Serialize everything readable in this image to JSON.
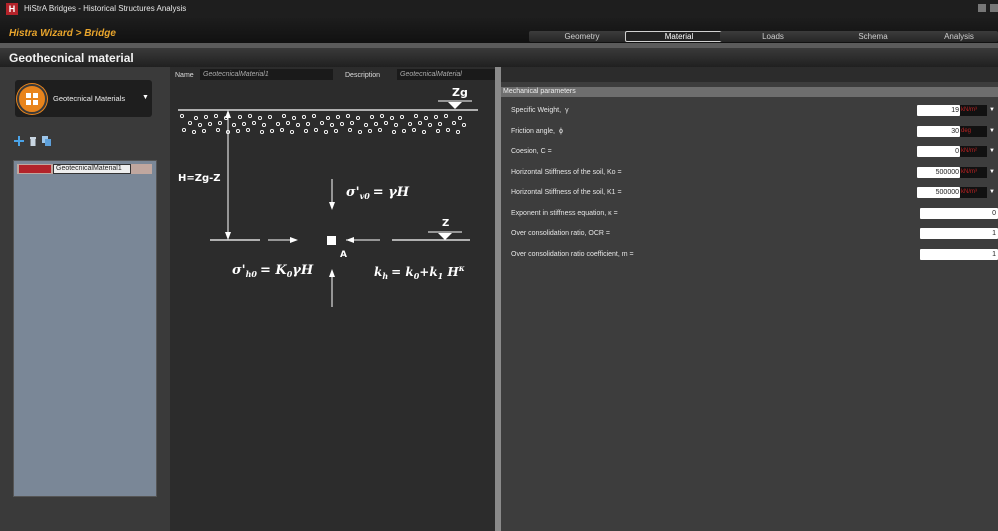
{
  "window": {
    "logo": "H",
    "title": "HiStrA Bridges - Historical Structures Analysis"
  },
  "wizard": {
    "breadcrumb": "Histra Wizard > Bridge",
    "tabs": [
      {
        "label": "Geometry",
        "active": false
      },
      {
        "label": "Material",
        "active": true
      },
      {
        "label": "Loads",
        "active": false
      },
      {
        "label": "Schema",
        "active": false
      },
      {
        "label": "Analysis",
        "active": false
      }
    ]
  },
  "section": {
    "title": "Geothecnical material"
  },
  "left": {
    "dropdown_label": "Geotecnical Materials",
    "materials": [
      {
        "name": "GeotecnicalMaterial1",
        "color": "#b2232a"
      }
    ]
  },
  "form": {
    "name_label": "Name",
    "name_value": "GeotecnicalMaterial1",
    "description_label": "Description",
    "description_value": "GeotecnicalMaterial"
  },
  "diagram": {
    "zg": "Zg",
    "h_label": "H=Zg-Z",
    "z": "Z",
    "point": "A",
    "sigma_v_lhs": "σ'",
    "sigma_v_sub": "v0",
    "sigma_v_rhs": "= γH",
    "sigma_h_lhs": "σ'",
    "sigma_h_sub": "h0",
    "sigma_h_rhs": "= K",
    "sigma_h_k_sub": "0",
    "sigma_h_tail": "γH",
    "kh_lhs": "k",
    "kh_sub": "h",
    "kh_rhs": "= k",
    "kh_k0_sub": "0",
    "kh_plus": "+k",
    "kh_k1_sub": "1",
    "kh_tail": " H",
    "kh_exp": "κ"
  },
  "mechanical": {
    "header": "Mechanical parameters",
    "params": [
      {
        "label": "Specific Weight,",
        "symbol": "γ",
        "value": "19",
        "unit": "kN/m³",
        "has_unit": true
      },
      {
        "label": "Friction angle,",
        "symbol": "ϕ",
        "value": "30",
        "unit": "deg",
        "has_unit": true
      },
      {
        "label": "Coesion, C =",
        "symbol": "",
        "value": "0",
        "unit": "kN/m²",
        "has_unit": true
      },
      {
        "label": "Horizontal Stiffness of the soil, Ko =",
        "symbol": "",
        "value": "500000",
        "unit": "kN/m³",
        "has_unit": true
      },
      {
        "label": "Horizontal Stiffness of the soil, K1 =",
        "symbol": "",
        "value": "500000",
        "unit": "kN/m³",
        "has_unit": true
      },
      {
        "label": "Exponent in stiffness equation, κ =",
        "symbol": "",
        "value": "0",
        "unit": "",
        "has_unit": false
      },
      {
        "label": "Over consolidation ratio, OCR =",
        "symbol": "",
        "value": "1",
        "unit": "",
        "has_unit": false
      },
      {
        "label": "Over consolidation ratio coefficient, m =",
        "symbol": "",
        "value": "1",
        "unit": "",
        "has_unit": false
      }
    ]
  },
  "colors": {
    "accent": "#e9a52c",
    "brand": "#b4232a",
    "unit_text": "#bb2222"
  }
}
